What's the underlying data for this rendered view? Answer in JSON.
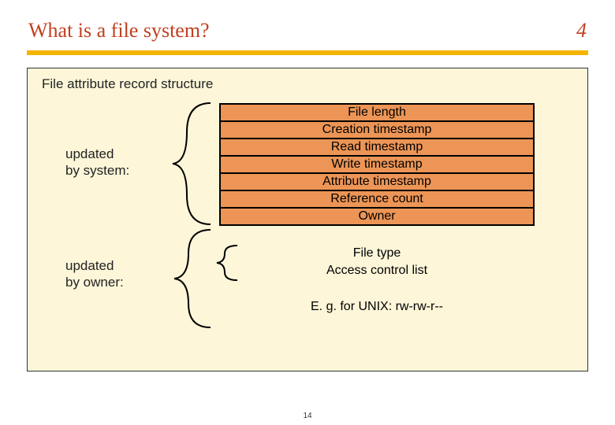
{
  "header": {
    "title": "What is a file system?",
    "slide_number": "4"
  },
  "subtitle": "File attribute record structure",
  "labels": {
    "system": "updated\nby system:",
    "owner": "updated\nby owner:"
  },
  "attributes": [
    "File length",
    "Creation timestamp",
    "Read timestamp",
    "Write timestamp",
    "Attribute timestamp",
    "Reference count",
    "Owner"
  ],
  "owner_extra": {
    "file_type": "File type",
    "acl": "Access control list"
  },
  "example": "E. g. for UNIX: rw-rw-r--",
  "page_number": "14"
}
